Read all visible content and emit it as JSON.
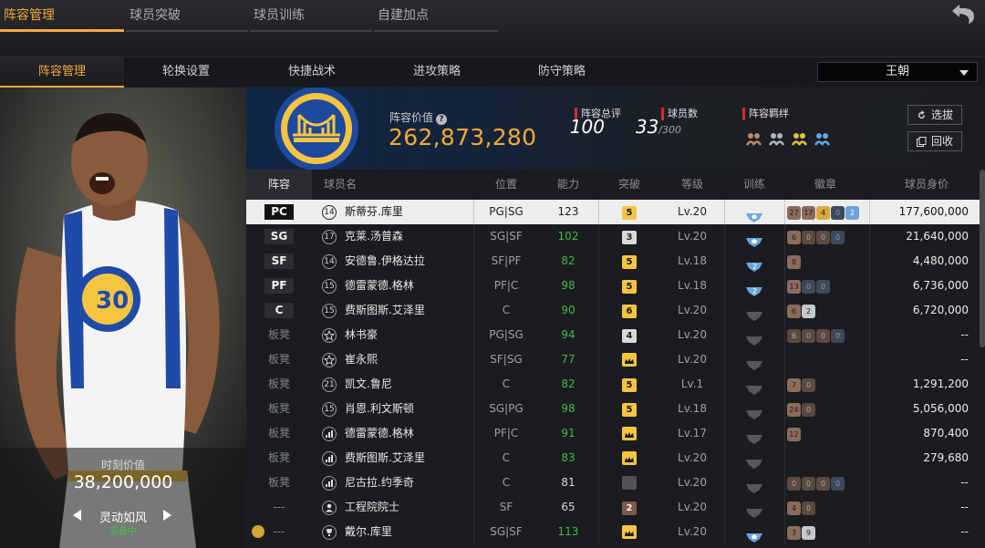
{
  "top_tabs": [
    "阵容管理",
    "球员突破",
    "球员训练",
    "自建加点"
  ],
  "sub_tabs": [
    "阵容管理",
    "轮换设置",
    "快捷战术",
    "进攻策略",
    "防守策略"
  ],
  "team_select": "王朝",
  "player_card": {
    "value_label": "时刻价值",
    "value": "38,200,000",
    "skill_name": "灵动如风",
    "skill_status": "装备中"
  },
  "team_info": {
    "value_label": "阵容价值",
    "value": "262,873,280",
    "rating_label": "阵容总评",
    "rating": "100",
    "count_label": "球员数",
    "count": "33",
    "count_max": "/300",
    "bond_label": "阵容羁绊",
    "btn_select": "选拔",
    "btn_recycle": "回收"
  },
  "table": {
    "headers": [
      "阵容",
      "球员名",
      "位置",
      "能力",
      "突破",
      "等级",
      "训练",
      "徽章",
      "球员身价"
    ],
    "rows": [
      {
        "pos": "PC",
        "num": "14",
        "name": "斯蒂芬.库里",
        "position": "PG|SG",
        "ability": "123",
        "breakthrough": "5",
        "level": "Lv.20",
        "badges": [
          "27",
          "17",
          "4",
          "0",
          "2"
        ],
        "value": "177,600,000"
      },
      {
        "pos": "SG",
        "num": "17",
        "name": "克莱.汤普森",
        "position": "SG|SF",
        "ability": "102",
        "breakthrough": "3",
        "level": "Lv.20",
        "badges": [
          "6",
          "0",
          "0",
          "0"
        ],
        "value": "21,640,000"
      },
      {
        "pos": "SF",
        "num": "14",
        "name": "安德鲁.伊格达拉",
        "position": "SF|PF",
        "ability": "82",
        "breakthrough": "5",
        "level": "Lv.18",
        "train_num": "2",
        "badges": [
          "8"
        ],
        "value": "4,480,000"
      },
      {
        "pos": "PF",
        "num": "15",
        "name": "德雷蒙德.格林",
        "position": "PF|C",
        "ability": "98",
        "breakthrough": "5",
        "level": "Lv.18",
        "train_num": "2",
        "badges": [
          "13",
          "0",
          "0"
        ],
        "value": "6,736,000"
      },
      {
        "pos": "C",
        "num": "15",
        "name": "费斯图斯.艾泽里",
        "position": "C",
        "ability": "90",
        "breakthrough": "6",
        "level": "Lv.20",
        "badges": [
          "6",
          "2"
        ],
        "value": "6,720,000"
      },
      {
        "pos": "板凳",
        "num": "",
        "name": "林书豪",
        "position": "PG|SG",
        "ability": "94",
        "breakthrough": "4",
        "level": "Lv.20",
        "badges": [
          "6",
          "0",
          "0",
          "0"
        ],
        "value": "--"
      },
      {
        "pos": "板凳",
        "num": "",
        "name": "崔永熙",
        "position": "SF|SG",
        "ability": "77",
        "breakthrough": "",
        "level": "Lv.20",
        "badges": [],
        "value": "--"
      },
      {
        "pos": "板凳",
        "num": "21",
        "name": "凯文.鲁尼",
        "position": "C",
        "ability": "82",
        "breakthrough": "5",
        "level": "Lv.1",
        "badges": [
          "7",
          "0"
        ],
        "value": "1,291,200"
      },
      {
        "pos": "板凳",
        "num": "15",
        "name": "肖恩.利文斯顿",
        "position": "SG|PG",
        "ability": "98",
        "breakthrough": "5",
        "level": "Lv.18",
        "badges": [
          "24",
          "0"
        ],
        "value": "5,056,000"
      },
      {
        "pos": "板凳",
        "num": "",
        "name": "德雷蒙德.格林",
        "position": "PF|C",
        "ability": "91",
        "breakthrough": "",
        "level": "Lv.17",
        "badges": [
          "12"
        ],
        "value": "870,400"
      },
      {
        "pos": "板凳",
        "num": "",
        "name": "费斯图斯.艾泽里",
        "position": "C",
        "ability": "83",
        "breakthrough": "",
        "level": "Lv.20",
        "badges": [],
        "value": "279,680"
      },
      {
        "pos": "板凳",
        "num": "",
        "name": "尼古拉.约季奇",
        "position": "C",
        "ability": "81",
        "breakthrough": "",
        "level": "Lv.20",
        "badges": [
          "0",
          "0",
          "0",
          "0"
        ],
        "value": "--"
      },
      {
        "pos": "---",
        "num": "",
        "name": "工程院院士",
        "position": "SF",
        "ability": "65",
        "breakthrough": "2",
        "level": "Lv.20",
        "badges": [
          "4",
          "0"
        ],
        "value": "--"
      },
      {
        "pos": "---",
        "num": "",
        "name": "戴尔.库里",
        "position": "SG|SF",
        "ability": "113",
        "breakthrough": "",
        "level": "Lv.20",
        "badges": [
          "3",
          "9"
        ],
        "value": "--"
      }
    ]
  }
}
